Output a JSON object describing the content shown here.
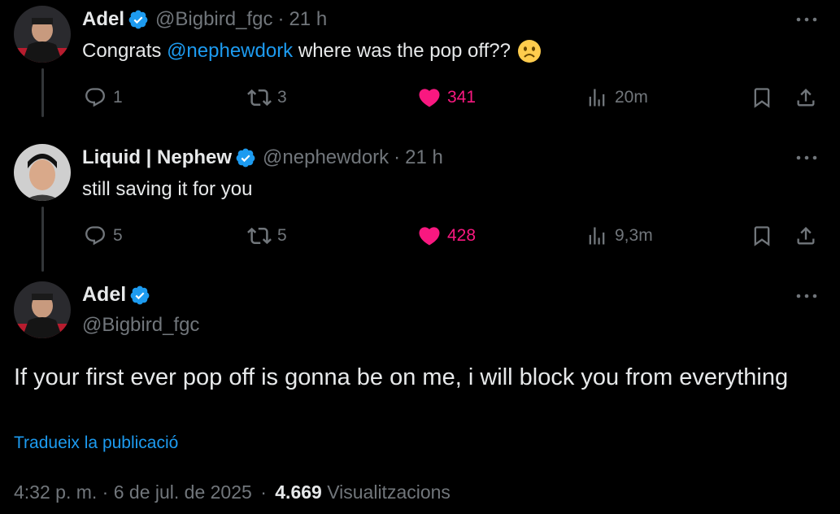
{
  "replies": [
    {
      "display_name": "Adel",
      "handle": "@Bigbird_fgc",
      "time": "21 h",
      "text_before": "Congrats ",
      "mention": "@nephewdork",
      "text_after": " where was the pop off??",
      "emoji": "frowning-face",
      "stats": {
        "replies": "1",
        "reposts": "3",
        "likes": "341",
        "views": "20m"
      }
    },
    {
      "display_name": "Liquid | Nephew",
      "handle": "@nephewdork",
      "time": "21 h",
      "text": "still saving it for you",
      "stats": {
        "replies": "5",
        "reposts": "5",
        "likes": "428",
        "views": "9,3m"
      }
    }
  ],
  "main_post": {
    "display_name": "Adel",
    "handle": "@Bigbird_fgc",
    "text": "If your first ever pop off is gonna be on me, i will block you from everything",
    "translate_label": "Tradueix la publicació",
    "timestamp": "4:32 p. m. · 6 de jul. de 2025",
    "separator": "·",
    "views_count": "4.669",
    "views_label": "Visualitzacions"
  },
  "separators": {
    "dot": "·"
  },
  "colors": {
    "background": "#000000",
    "text": "#e7e9ea",
    "muted": "#71767b",
    "accent": "#1d9bf0",
    "like": "#f91880",
    "verified": "#1d9bf0"
  }
}
